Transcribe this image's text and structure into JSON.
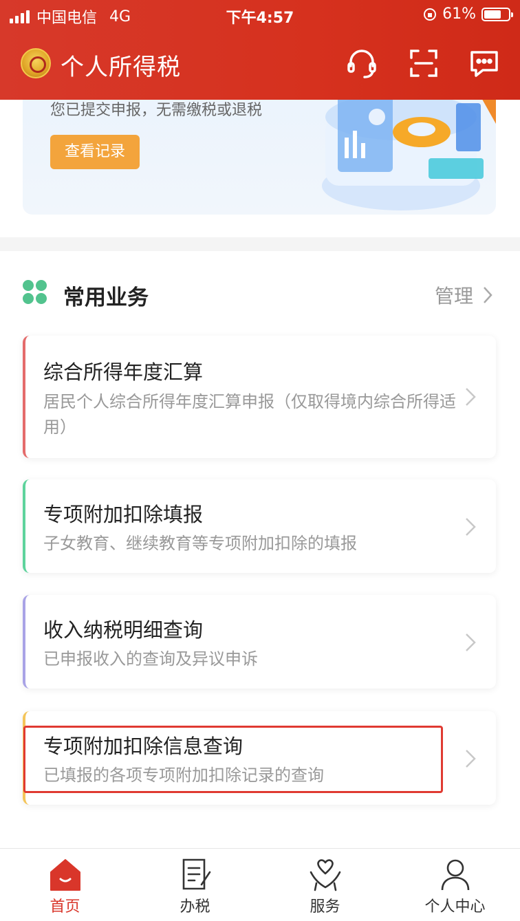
{
  "status_bar": {
    "carrier": "中国电信",
    "network": "4G",
    "time": "下午4:57",
    "battery": "61%"
  },
  "header": {
    "title": "个人所得税",
    "icons": [
      "headset-icon",
      "scan-icon",
      "message-icon"
    ]
  },
  "banner": {
    "subtitle": "您已提交申报，无需缴税或退税",
    "record_button": "查看记录"
  },
  "section": {
    "title": "常用业务",
    "manage_label": "管理"
  },
  "cards": [
    {
      "title": "综合所得年度汇算",
      "desc": "居民个人综合所得年度汇算申报（仅取得境内综合所得适用）",
      "accent": "#e46b6b"
    },
    {
      "title": "专项附加扣除填报",
      "desc": "子女教育、继续教育等专项附加扣除的填报",
      "accent": "#5ed39c"
    },
    {
      "title": "收入纳税明细查询",
      "desc": "已申报收入的查询及异议申诉",
      "accent": "#a9a3e6"
    },
    {
      "title": "专项附加扣除信息查询",
      "desc": "已填报的各项专项附加扣除记录的查询",
      "accent": "#f4c55a"
    }
  ],
  "tabbar": {
    "items": [
      {
        "label": "首页",
        "icon": "home-icon"
      },
      {
        "label": "办税",
        "icon": "document-icon"
      },
      {
        "label": "服务",
        "icon": "heart-hands-icon"
      },
      {
        "label": "个人中心",
        "icon": "person-icon"
      }
    ],
    "active": "首页"
  },
  "colors": {
    "brand_red": "#d6311e",
    "record_button": "#f3a43c",
    "highlight_box": "#e03a32"
  }
}
